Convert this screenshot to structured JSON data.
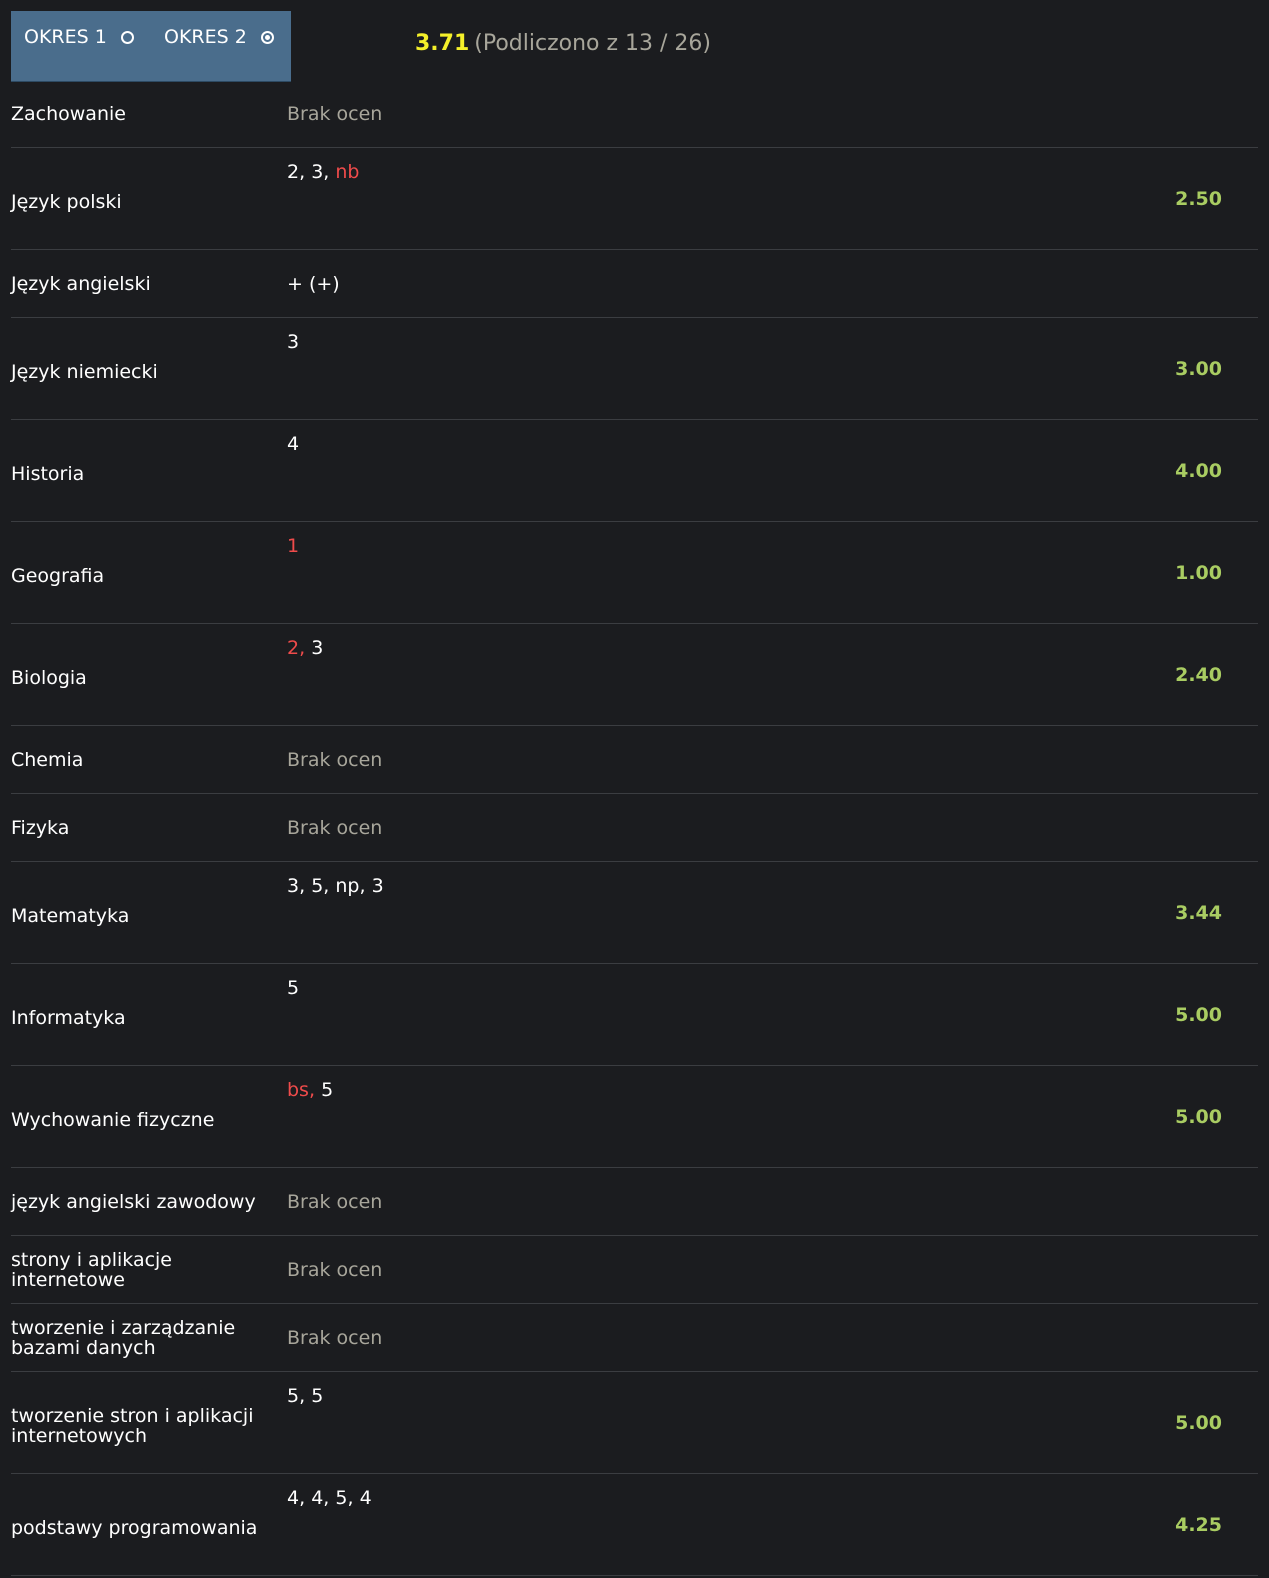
{
  "periods": [
    {
      "label": "OKRES 1",
      "selected": false
    },
    {
      "label": "OKRES 2",
      "selected": true
    }
  ],
  "overall": {
    "average": "3.71",
    "note": "(Podliczono z 13 / 26)"
  },
  "colors": {
    "background": "#1b1c1f",
    "period_box": "#4a6d8c",
    "overall_average": "#f5f02a",
    "subject_average": "#a9cc62",
    "bad_grade": "#ef4b4b",
    "muted": "#a8a69b"
  },
  "no_grades_label": "Brak ocen",
  "subjects": [
    {
      "name": "Zachowanie",
      "grades": [],
      "average": ""
    },
    {
      "name": "Język polski",
      "grades": [
        {
          "v": "2",
          "bad": false
        },
        {
          "v": "3",
          "bad": false
        },
        {
          "v": "nb",
          "bad": true
        }
      ],
      "average": "2.50"
    },
    {
      "name": "Język angielski",
      "grades": [
        {
          "v": "+ (+)",
          "bad": false
        }
      ],
      "average": ""
    },
    {
      "name": "Język niemiecki",
      "grades": [
        {
          "v": "3",
          "bad": false
        }
      ],
      "average": "3.00"
    },
    {
      "name": "Historia",
      "grades": [
        {
          "v": "4",
          "bad": false
        }
      ],
      "average": "4.00"
    },
    {
      "name": "Geografia",
      "grades": [
        {
          "v": "1",
          "bad": true
        }
      ],
      "average": "1.00"
    },
    {
      "name": "Biologia",
      "grades": [
        {
          "v": "2",
          "bad": true
        },
        {
          "v": "3",
          "bad": false
        }
      ],
      "average": "2.40"
    },
    {
      "name": "Chemia",
      "grades": [],
      "average": ""
    },
    {
      "name": "Fizyka",
      "grades": [],
      "average": ""
    },
    {
      "name": "Matematyka",
      "grades": [
        {
          "v": "3",
          "bad": false
        },
        {
          "v": "5",
          "bad": false
        },
        {
          "v": "np",
          "bad": false
        },
        {
          "v": "3",
          "bad": false
        }
      ],
      "average": "3.44"
    },
    {
      "name": "Informatyka",
      "grades": [
        {
          "v": "5",
          "bad": false
        }
      ],
      "average": "5.00"
    },
    {
      "name": "Wychowanie fizyczne",
      "grades": [
        {
          "v": "bs",
          "bad": true
        },
        {
          "v": "5",
          "bad": false
        }
      ],
      "average": "5.00"
    },
    {
      "name": "język angielski zawodowy",
      "grades": [],
      "average": ""
    },
    {
      "name": "strony i aplikacje internetowe",
      "grades": [],
      "average": ""
    },
    {
      "name": "tworzenie i zarządzanie bazami danych",
      "grades": [],
      "average": ""
    },
    {
      "name": "tworzenie stron i aplikacji internetowych",
      "grades": [
        {
          "v": "5",
          "bad": false
        },
        {
          "v": "5",
          "bad": false
        }
      ],
      "average": "5.00"
    },
    {
      "name": "podstawy programowania",
      "grades": [
        {
          "v": "4",
          "bad": false
        },
        {
          "v": "4",
          "bad": false
        },
        {
          "v": "5",
          "bad": false
        },
        {
          "v": "4",
          "bad": false
        }
      ],
      "average": "4.25"
    }
  ]
}
